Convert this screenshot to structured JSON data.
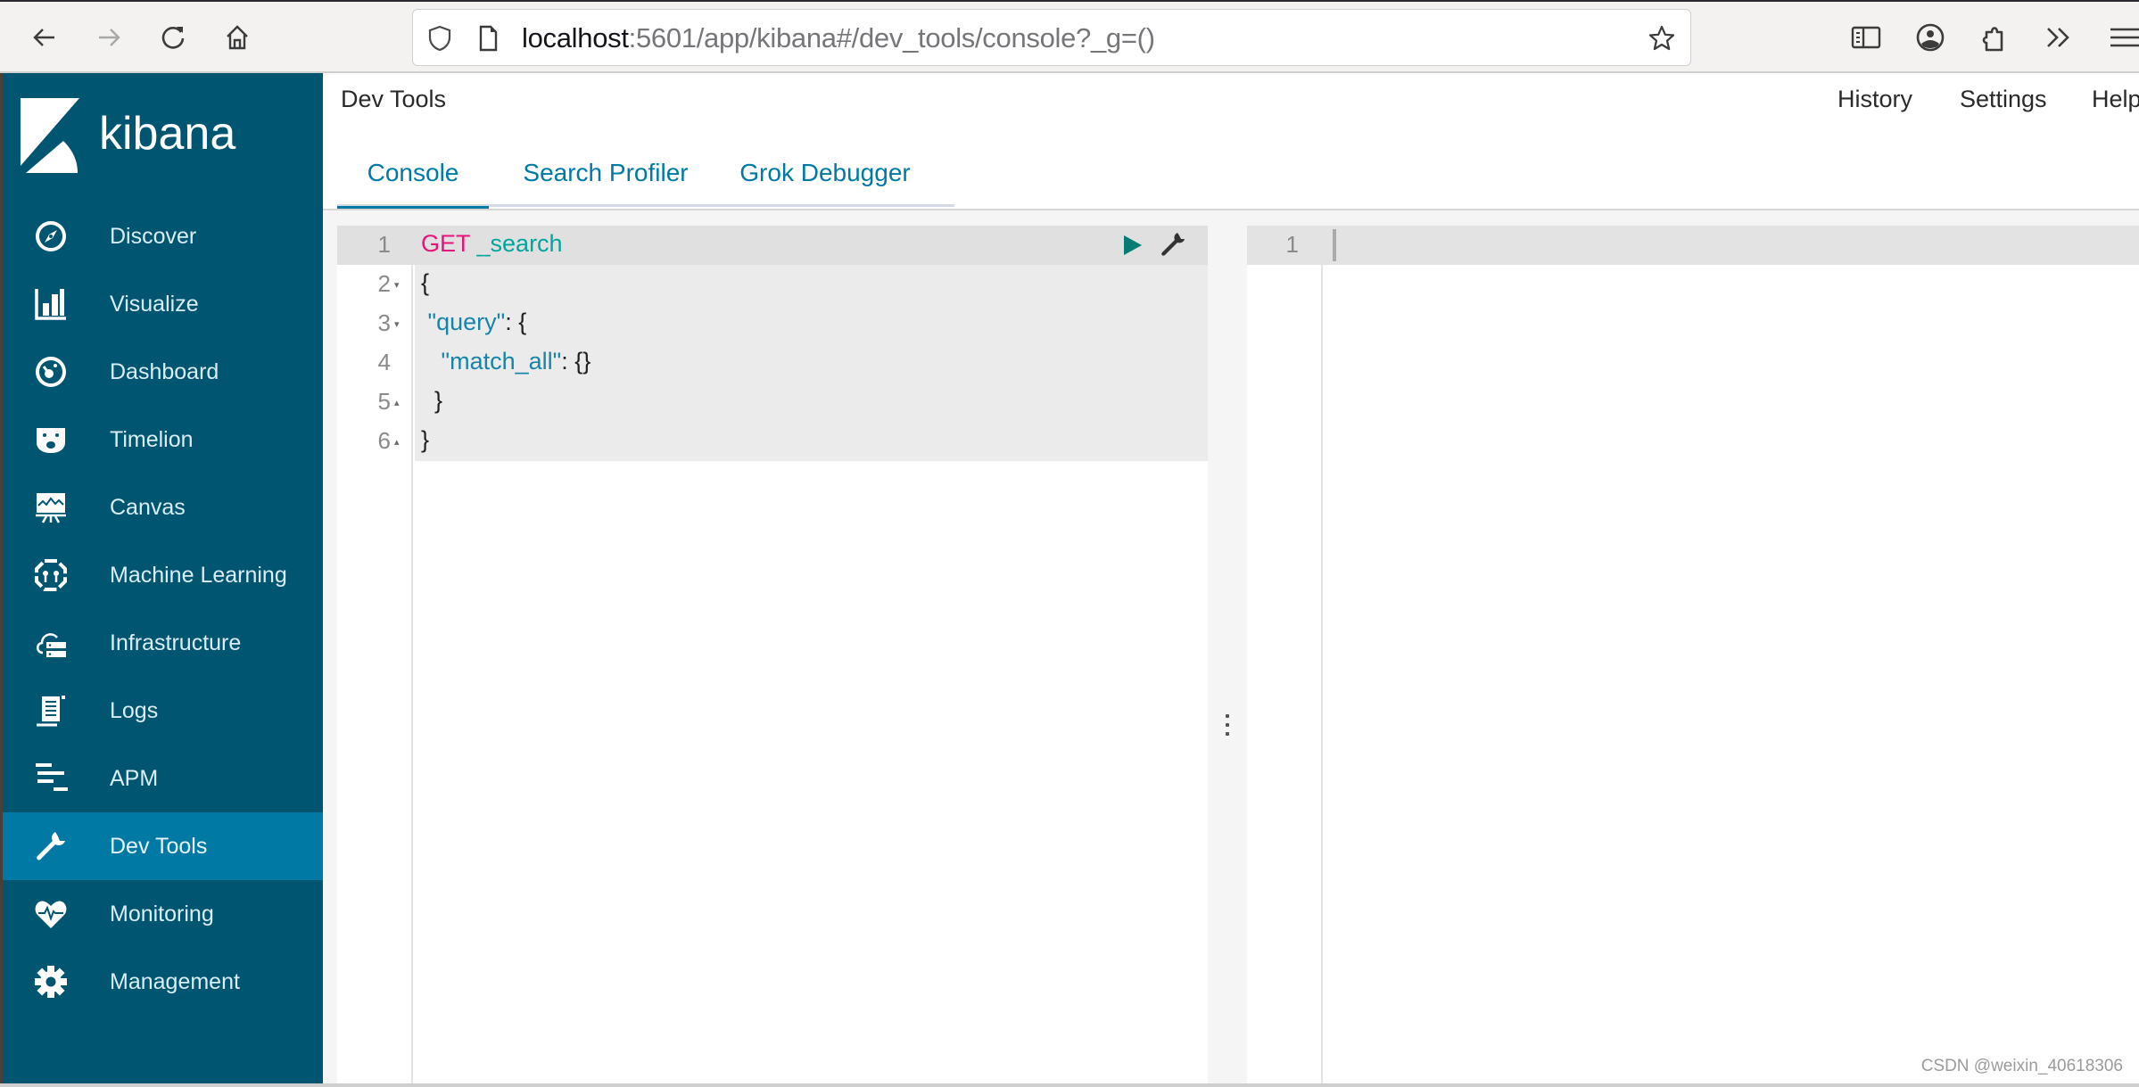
{
  "browser": {
    "url_host": "localhost",
    "url_rest": ":5601/app/kibana#/dev_tools/console?_g=()",
    "icons": [
      "back-icon",
      "forward-icon",
      "reload-icon",
      "home-icon",
      "shield-icon",
      "page-icon",
      "bookmark-star-icon",
      "reader-view-icon",
      "account-icon",
      "extensions-icon",
      "overflow-chevrons-icon",
      "menu-icon"
    ]
  },
  "sidebar": {
    "logo_text": "kibana",
    "items": [
      {
        "label": "Discover",
        "icon": "compass-icon",
        "active": false
      },
      {
        "label": "Visualize",
        "icon": "bar-chart-icon",
        "active": false
      },
      {
        "label": "Dashboard",
        "icon": "dashboard-icon",
        "active": false
      },
      {
        "label": "Timelion",
        "icon": "timelion-icon",
        "active": false
      },
      {
        "label": "Canvas",
        "icon": "canvas-icon",
        "active": false
      },
      {
        "label": "Machine Learning",
        "icon": "machine-learning-icon",
        "active": false
      },
      {
        "label": "Infrastructure",
        "icon": "infrastructure-icon",
        "active": false
      },
      {
        "label": "Logs",
        "icon": "logs-icon",
        "active": false
      },
      {
        "label": "APM",
        "icon": "apm-icon",
        "active": false
      },
      {
        "label": "Dev Tools",
        "icon": "wrench-icon",
        "active": true
      },
      {
        "label": "Monitoring",
        "icon": "heartbeat-icon",
        "active": false
      },
      {
        "label": "Management",
        "icon": "gear-icon",
        "active": false
      }
    ],
    "colors": {
      "background": "#005571",
      "active": "#0079a5"
    }
  },
  "header": {
    "title": "Dev Tools",
    "links": [
      "History",
      "Settings",
      "Help"
    ]
  },
  "tabs": [
    {
      "label": "Console",
      "active": true
    },
    {
      "label": "Search Profiler",
      "active": false
    },
    {
      "label": "Grok Debugger",
      "active": false
    }
  ],
  "editor": {
    "lines": [
      {
        "n": "1",
        "fold": "",
        "method": "GET",
        "path": " _search"
      },
      {
        "n": "2",
        "fold": "▾",
        "text": "{"
      },
      {
        "n": "3",
        "fold": "▾",
        "key": " \"query\"",
        "text": ": {"
      },
      {
        "n": "4",
        "fold": "",
        "key": "   \"match_all\"",
        "text": ": {}"
      },
      {
        "n": "5",
        "fold": "▴",
        "text": "  }"
      },
      {
        "n": "6",
        "fold": "▴",
        "text": "}"
      }
    ],
    "actions": [
      "run-request-button",
      "wrench-settings-button"
    ]
  },
  "output": {
    "lines": [
      {
        "n": "1",
        "text": ""
      }
    ]
  },
  "watermark": "CSDN @weixin_40618306"
}
